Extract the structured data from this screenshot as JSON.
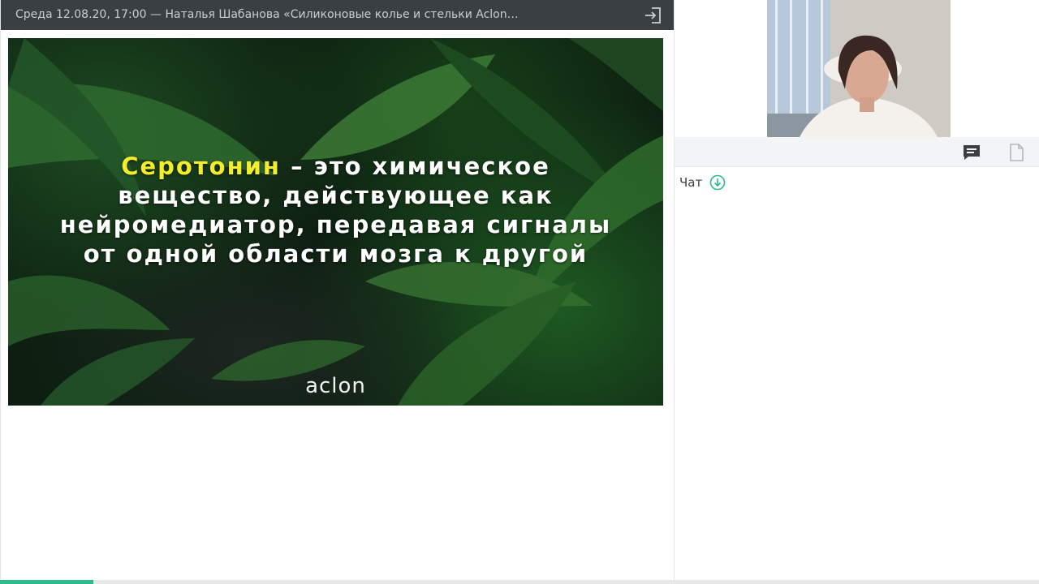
{
  "header": {
    "title": "Среда 12.08.20, 17:00 — Наталья Шабанова «Силиконовые колье и стельки Aclon…",
    "exit_icon": "exit-icon"
  },
  "slide": {
    "highlight": "Серотонин",
    "text_rest_line1": " – это химическое",
    "line2": "вещество, действующее как",
    "line3": "нейромедиатор, передавая сигналы",
    "line4": "от одной области мозга к другой",
    "logo": "aclon",
    "colors": {
      "highlight": "#f4ec2c",
      "text": "#ffffff"
    }
  },
  "side_panel": {
    "tabs": [
      {
        "icon": "chat-icon",
        "active": true
      },
      {
        "icon": "file-icon",
        "active": false
      }
    ],
    "chat_title": "Чат",
    "scroll_icon": "arrow-down-circle-icon"
  },
  "playback": {
    "progress_fraction": 0.09,
    "color": "#2dbb8d"
  }
}
